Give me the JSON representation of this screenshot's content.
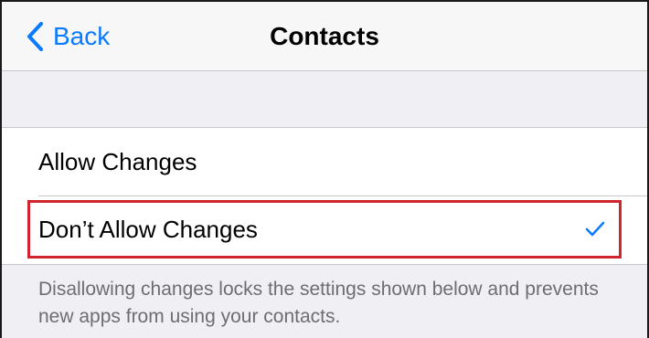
{
  "nav": {
    "back_label": "Back",
    "title": "Contacts"
  },
  "options": {
    "allow_changes": "Allow Changes",
    "dont_allow_changes": "Don’t Allow Changes",
    "selected": "dont_allow_changes"
  },
  "footer": {
    "description": "Disallowing changes locks the settings shown below and prevents new apps from using your contacts."
  },
  "colors": {
    "accent": "#0a7aff",
    "highlight_border": "#d0242f",
    "group_background": "#efeff4",
    "footer_text": "#6d6d72"
  },
  "icons": {
    "back": "chevron-left-icon",
    "selected": "checkmark-icon"
  }
}
